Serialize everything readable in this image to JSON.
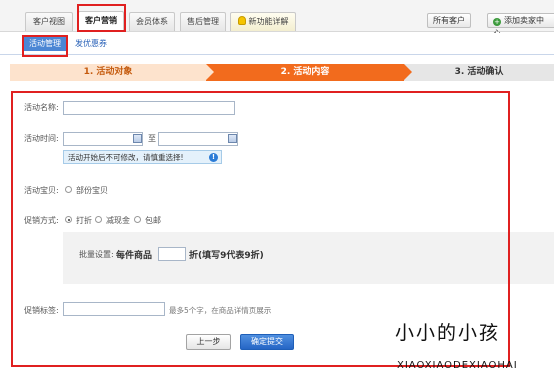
{
  "nav": {
    "tabs": [
      {
        "label": "客户视图"
      },
      {
        "label": "客户营销"
      },
      {
        "label": "会员体系"
      },
      {
        "label": "售后管理"
      },
      {
        "label": "新功能详解"
      }
    ],
    "right_buttons": [
      {
        "label": "所有客户"
      },
      {
        "label": "添加卖家中心"
      }
    ]
  },
  "subnav": {
    "tabs": [
      {
        "label": "活动管理"
      },
      {
        "label": "发优惠券"
      }
    ]
  },
  "steps": [
    {
      "label": "1. 活动对象"
    },
    {
      "label": "2. 活动内容"
    },
    {
      "label": "3. 活动确认"
    }
  ],
  "form": {
    "name_label": "活动名称:",
    "name_value": "",
    "time_label": "活动时间:",
    "time_start": "",
    "time_sep": "至",
    "time_end": "",
    "time_tip": "活动开始后不可修改，请慎重选择!",
    "items_label": "活动宝贝:",
    "items_option": "部份宝贝",
    "promo_label": "促销方式:",
    "promo_options": [
      {
        "label": "打折",
        "selected": true
      },
      {
        "label": "减现金",
        "selected": false
      },
      {
        "label": "包邮",
        "selected": false
      }
    ],
    "batch_label": "批量设置:",
    "batch_prefix": "每件商品",
    "batch_value": "",
    "batch_suffix": "折(填写9代表9折)",
    "tag_label": "促销标签:",
    "tag_value": "",
    "tag_hint": "最多5个字，在商品详情页展示",
    "prev_button": "上一步",
    "confirm_button": "确定提交"
  },
  "watermark": {
    "title": "小小的小孩",
    "subtitle": "XIAOXIAODEXIAOHAI"
  },
  "colors": {
    "highlight_border": "#e02020",
    "step_active": "#f26b1d",
    "step_done": "#fde3cd",
    "primary_button": "#2565c5"
  }
}
